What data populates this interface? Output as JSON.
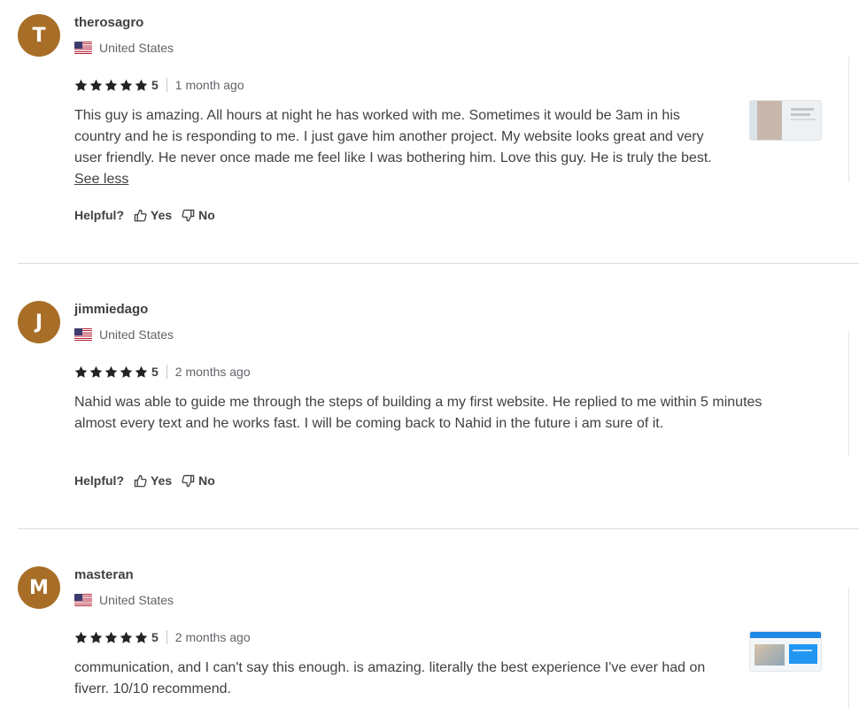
{
  "reviews": [
    {
      "initial": "T",
      "username": "therosagro",
      "country": "United States",
      "rating": "5",
      "time": "1 month ago",
      "text": "This guy is amazing. All hours at night he has worked with me. Sometimes it would be 3am in his country and he is responding to me. I just gave him another project. My website looks great and very user friendly. He never once made me feel like I was bothering him. Love this guy. He is truly the best. ",
      "see_less": "See less",
      "helpful_label": "Helpful?",
      "yes_label": "Yes",
      "no_label": "No"
    },
    {
      "initial": "J",
      "username": "jimmiedago",
      "country": "United States",
      "rating": "5",
      "time": "2 months ago",
      "text": "Nahid was able to guide me through the steps of building a my first website. He replied to me within 5 minutes almost every text and he works fast. I will be coming back to Nahid in the future i am sure of it.",
      "helpful_label": "Helpful?",
      "yes_label": "Yes",
      "no_label": "No"
    },
    {
      "initial": "M",
      "username": "masteran",
      "country": "United States",
      "rating": "5",
      "time": "2 months ago",
      "text": "communication, and I can't say this enough. is amazing. literally the best experience I've ever had on fiverr. 10/10 recommend."
    }
  ],
  "colors": {
    "avatar": "#a86e27",
    "text": "#404145",
    "muted": "#62646a",
    "divider": "#dadbdd",
    "star": "#222325"
  },
  "icons": [
    "us-flag-icon",
    "star-icon",
    "thumbs-up-icon",
    "thumbs-down-icon"
  ]
}
